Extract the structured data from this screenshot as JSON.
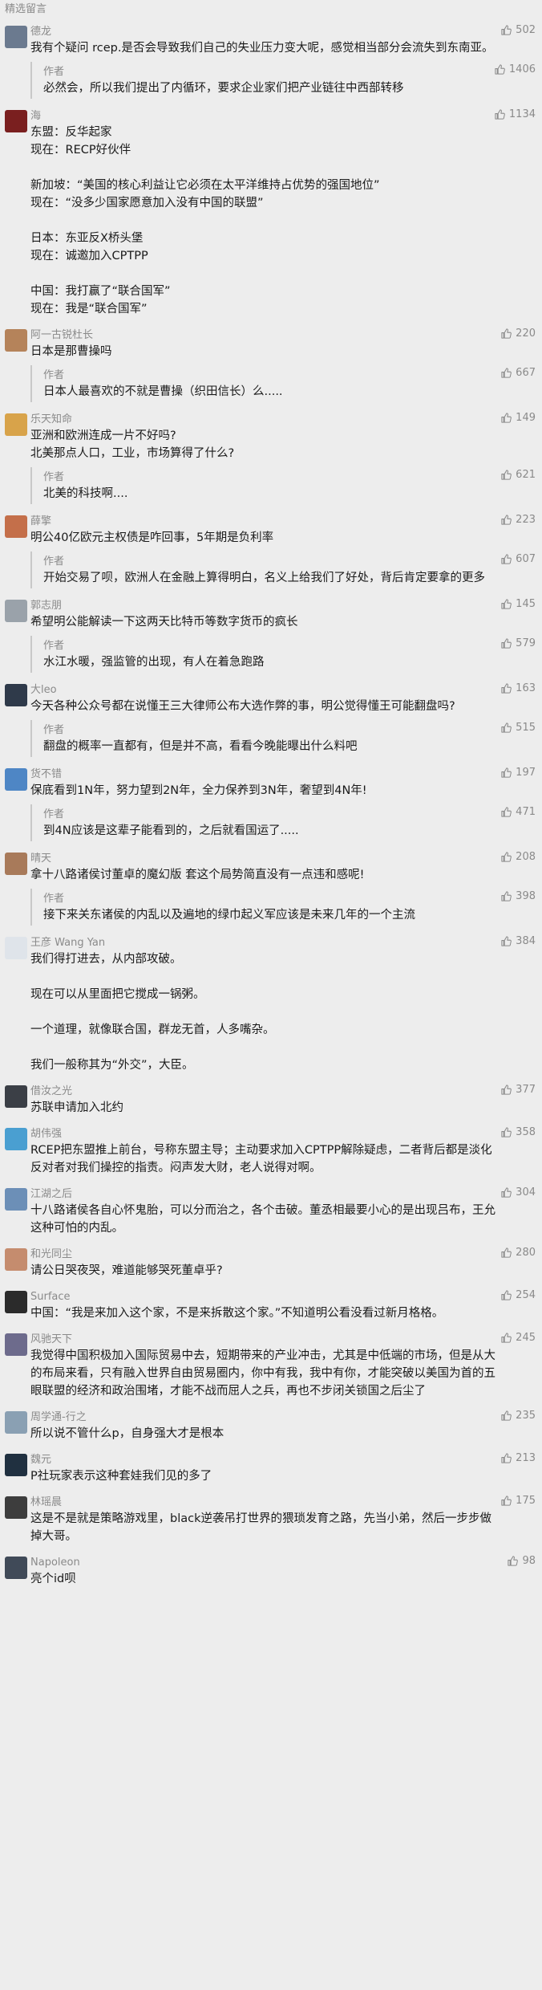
{
  "section_title": "精选留言",
  "icons": {
    "like": "thumbs-up-icon",
    "emoji": "emoji-icon"
  },
  "comments": [
    {
      "nick": "德龙",
      "likes": "502",
      "text": "我有个疑问 rcep.是否会导致我们自己的失业压力变大呢，感觉相当部分会流失到东南亚。",
      "reply": {
        "author": "作者",
        "text": "必然会，所以我们提出了内循环，要求企业家们把产业链往中西部转移",
        "likes": "1406"
      }
    },
    {
      "nick": "海",
      "likes": "1134",
      "text": "东盟：反华起家\n现在：RECP好伙伴\n\n新加坡：“美国的核心利益让它必须在太平洋维持占优势的强国地位”\n现在：“没多少国家愿意加入没有中国的联盟”\n\n日本：东亚反X桥头堡\n现在：诚邀加入CPTPP\n\n中国：我打赢了“联合国军”\n现在：我是“联合国军”"
    },
    {
      "nick": "阿一古锐杜长",
      "likes": "220",
      "text": "日本是那曹操吗",
      "reply": {
        "author": "作者",
        "text": "日本人最喜欢的不就是曹操（织田信长）么.....",
        "likes": "667"
      }
    },
    {
      "nick": "乐天知命",
      "likes": "149",
      "text": "亚洲和欧洲连成一片不好吗?\n北美那点人口，工业，市场算得了什么?",
      "reply": {
        "author": "作者",
        "text": "北美的科技啊....",
        "likes": "621"
      }
    },
    {
      "nick": "薛擎",
      "likes": "223",
      "text": "明公40亿欧元主权债是咋回事，5年期是负利率",
      "reply": {
        "author": "作者",
        "text": "开始交易了呗，欧洲人在金融上算得明白，名义上给我们了好处，背后肯定要拿的更多",
        "likes": "607"
      }
    },
    {
      "nick": "郭志朋",
      "likes": "145",
      "text": "希望明公能解读一下这两天比特币等数字货币的疯长",
      "reply": {
        "author": "作者",
        "text": "水江水暖，强监管的出现，有人在着急跑路",
        "likes": "579"
      }
    },
    {
      "nick": "大leo",
      "likes": "163",
      "text": "今天各种公众号都在说懂王三大律师公布大选作弊的事，明公觉得懂王可能翻盘吗?",
      "reply": {
        "author": "作者",
        "text": "翻盘的概率一直都有，但是并不高，看看今晚能曝出什么料吧",
        "likes": "515"
      }
    },
    {
      "nick": "货不错",
      "likes": "197",
      "text": "保底看到1N年，努力望到2N年，全力保养到3N年，奢望到4N年!",
      "reply": {
        "author": "作者",
        "text": "到4N应该是这辈子能看到的，之后就看国运了.....",
        "likes": "471"
      }
    },
    {
      "nick": "晴天",
      "likes": "208",
      "text": "拿十八路诸侯讨董卓的魔幻版 套这个局势简直没有一点违和感呢!",
      "reply": {
        "author": "作者",
        "text": "接下来关东诸侯的内乱以及遍地的绿巾起义军应该是未来几年的一个主流",
        "likes": "398"
      }
    },
    {
      "nick": "王彦 Wang Yan",
      "likes": "384",
      "text": "我们得打进去，从内部攻破。\n\n现在可以从里面把它搅成一锅粥。\n\n一个道理，就像联合国，群龙无首，人多嘴杂。\n\n我们一般称其为“外交”，大臣。"
    },
    {
      "nick": "借汝之光",
      "likes": "377",
      "text": "苏联申请加入北约"
    },
    {
      "nick": "胡伟强",
      "likes": "358",
      "text": "RCEP把东盟推上前台，号称东盟主导；主动要求加入CPTPP解除疑虑，二者背后都是淡化反对者对我们操控的指责。闷声发大财，老人说得对啊。"
    },
    {
      "nick": "江湖之后",
      "likes": "304",
      "text": "十八路诸侯各自心怀鬼胎，可以分而治之，各个击破。董丞相最要小心的是出现吕布，王允这种可怕的内乱。"
    },
    {
      "nick": "和光同尘",
      "likes": "280",
      "text": "请公日哭夜哭，难道能够哭死董卓乎?"
    },
    {
      "nick": "Surface",
      "likes": "254",
      "text": "中国：“我是来加入这个家，不是来拆散这个家。”不知道明公看没看过新月格格。"
    },
    {
      "nick": "风驰天下",
      "likes": "245",
      "text": "我觉得中国积极加入国际贸易中去，短期带来的产业冲击，尤其是中低端的市场，但是从大的布局来看，只有融入世界自由贸易圈内，你中有我，我中有你，才能突破以美国为首的五眼联盟的经济和政治围堵，才能不战而屈人之兵，再也不步闭关锁国之后尘了"
    },
    {
      "nick": "周学通-行之",
      "likes": "235",
      "text": "所以说不管什么p，自身强大才是根本"
    },
    {
      "nick": "魏元",
      "likes": "213",
      "text": "P社玩家表示这种套娃我们见的多了"
    },
    {
      "nick": "林瑶晨",
      "likes": "175",
      "text": "这是不是就是策略游戏里，black逆袭吊打世界的猥琐发育之路，先当小弟，然后一步步做掉大哥。"
    },
    {
      "nick": "Napoleon",
      "likes": "98",
      "text": "亮个id呗"
    }
  ]
}
